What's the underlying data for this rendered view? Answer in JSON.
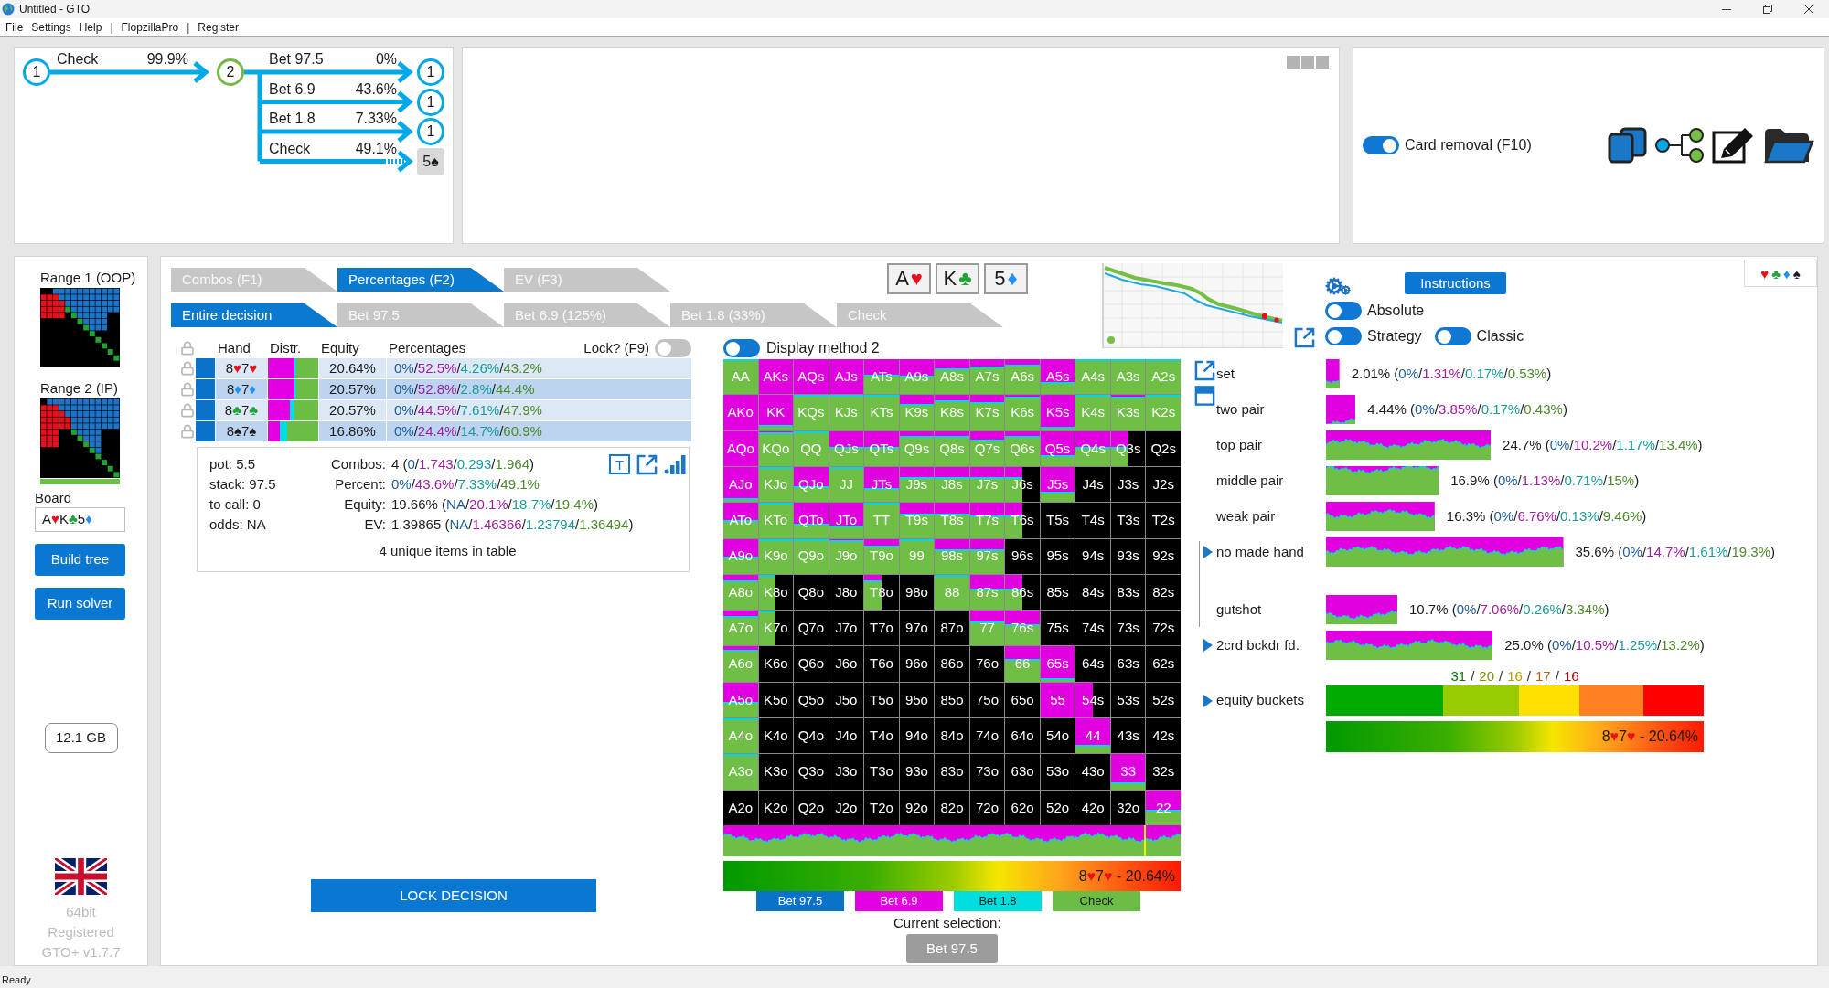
{
  "window": {
    "title": "Untitled - GTO"
  },
  "menu": [
    {
      "kind": "item",
      "label": "File"
    },
    {
      "kind": "item",
      "label": "Settings"
    },
    {
      "kind": "item",
      "label": "Help"
    },
    {
      "kind": "separator",
      "label": "|"
    },
    {
      "kind": "item",
      "label": "FlopzillaPro"
    },
    {
      "kind": "separator",
      "label": "|"
    },
    {
      "kind": "item",
      "label": "Register"
    }
  ],
  "tree": {
    "node": "1",
    "kind": "oop",
    "children": [
      {
        "action": "Check",
        "share": "99.9%",
        "node": "2",
        "kind": "ip",
        "children": [
          {
            "action": "Bet 97.5",
            "share": "0%",
            "node": "1",
            "kind": "oop"
          },
          {
            "action": "Bet 6.9",
            "share": "43.6%",
            "node": "1",
            "kind": "oop"
          },
          {
            "action": "Bet 1.8",
            "share": "7.33%",
            "node": "1",
            "kind": "oop"
          },
          {
            "action": "Check",
            "share": "49.1%",
            "node": "5♠",
            "kind": "card"
          }
        ]
      }
    ]
  },
  "card_removal": {
    "label": "Card removal (F10)",
    "on": true,
    "kind": "switch"
  },
  "sidebar": {
    "ranges": [
      {
        "label": "Range 1 (OOP)"
      },
      {
        "label": "Range 2 (IP)",
        "level": 1
      }
    ],
    "board": {
      "label": "Board",
      "cards": [
        {
          "rank": "A",
          "suit": "♥",
          "color": "#e8101c"
        },
        {
          "rank": "K",
          "suit": "♣",
          "color": "#21a336"
        },
        {
          "rank": "5",
          "suit": "♦",
          "color": "#1e90ff"
        }
      ]
    },
    "buttons": [
      "Build tree",
      "Run solver"
    ],
    "memory": "12.1 GB",
    "footer": [
      "64bit",
      "Registered",
      "GTO+ v1.7.7"
    ]
  },
  "tabs": [
    {
      "label": "Combos (F1)",
      "selected": false
    },
    {
      "label": "Percentages (F2)",
      "selected": true
    },
    {
      "label": "EV (F3)",
      "selected": false
    }
  ],
  "decision_tabs": [
    {
      "label": "Entire decision",
      "selected": true
    },
    {
      "label": "Bet 97.5",
      "selected": false
    },
    {
      "label": "Bet 6.9 (125%)",
      "selected": false
    },
    {
      "label": "Bet 1.8 (33%)",
      "selected": false
    },
    {
      "label": "Check",
      "selected": false
    }
  ],
  "board_cards": [
    {
      "rank": "A",
      "suit": "♥",
      "color": "#e8101c"
    },
    {
      "rank": "K",
      "suit": "♣",
      "color": "#21a336"
    },
    {
      "rank": "5",
      "suit": "♦",
      "color": "#1e90ff"
    }
  ],
  "table": {
    "columns": [
      "Hand",
      "Distr.",
      "Equity",
      "Percentages"
    ],
    "lock": {
      "label": "Lock? (F9)",
      "on": false,
      "kind": "switch"
    },
    "rows": [
      {
        "cards": [
          {
            "rank": "8",
            "suit": "♥",
            "color": "#e8101c"
          },
          {
            "rank": "7",
            "suit": "♥",
            "color": "#e8101c"
          }
        ],
        "equity": "20.64%",
        "values": [
          "0%",
          "52.5%",
          "4.26%",
          "43.2%"
        ],
        "sep": "/"
      },
      {
        "cards": [
          {
            "rank": "8",
            "suit": "♦",
            "color": "#1e90ff"
          },
          {
            "rank": "7",
            "suit": "♦",
            "color": "#1e90ff"
          }
        ],
        "equity": "20.57%",
        "values": [
          "0%",
          "52.8%",
          "2.8%",
          "44.4%"
        ],
        "sep": "/"
      },
      {
        "cards": [
          {
            "rank": "8",
            "suit": "♣",
            "color": "#21a336"
          },
          {
            "rank": "7",
            "suit": "♣",
            "color": "#21a336"
          }
        ],
        "equity": "20.57%",
        "values": [
          "0%",
          "44.5%",
          "7.61%",
          "47.9%"
        ],
        "sep": "/"
      },
      {
        "cards": [
          {
            "rank": "8",
            "suit": "♠",
            "color": "#1c1c1c"
          },
          {
            "rank": "7",
            "suit": "♠",
            "color": "#1c1c1c"
          }
        ],
        "equity": "16.86%",
        "values": [
          "0%",
          "24.4%",
          "14.7%",
          "60.9%"
        ],
        "sep": "/"
      }
    ]
  },
  "summary": {
    "left": [
      "pot: 5.5",
      "stack: 97.5",
      "to call: 0",
      "odds: NA"
    ],
    "right": [
      {
        "label": "Combos:",
        "lead": "4 (",
        "values": [
          "0",
          "1.743",
          "0.293",
          "1.964"
        ],
        "sep": "/",
        "tail": ")"
      },
      {
        "label": "Percent:",
        "values": [
          "0%",
          "43.6%",
          "7.33%",
          "49.1%"
        ],
        "sep": "/"
      },
      {
        "label": "Equity:",
        "lead": "19.66% (",
        "values": [
          "NA",
          "20.1%",
          "18.7%",
          "19.4%"
        ],
        "sep": "/",
        "tail": ")"
      },
      {
        "label": "EV:",
        "lead": "1.39865 (",
        "values": [
          "NA",
          "1.46366",
          "1.23794",
          "1.36494"
        ],
        "sep": "/",
        "tail": ")"
      }
    ],
    "text_button": "T",
    "footer": "4 unique items in table"
  },
  "lock_button": "LOCK DECISION",
  "display": {
    "label": "Display method 2",
    "on": false,
    "kind": "choice"
  },
  "grid": {
    "rows": [
      {
        "cells": [
          {
            "label": "AA",
            "kind": "full",
            "level": 0
          },
          {
            "label": "AKs",
            "kind": "full",
            "level": 1
          },
          {
            "label": "AQs",
            "kind": "full",
            "level": 1
          },
          {
            "label": "AJs",
            "kind": "full",
            "level": 1
          },
          {
            "label": "ATs",
            "kind": "full",
            "level": 0.5
          },
          {
            "label": "A9s",
            "kind": "full",
            "level": 0.52
          },
          {
            "label": "A8s",
            "kind": "full",
            "level": 0.32
          },
          {
            "label": "A7s",
            "kind": "full",
            "level": 0.25
          },
          {
            "label": "A6s",
            "kind": "full",
            "level": 0.2
          },
          {
            "label": "A5s",
            "kind": "full",
            "level": 0.7
          },
          {
            "label": "A4s",
            "kind": "full",
            "level": 0.03
          },
          {
            "label": "A3s",
            "kind": "full",
            "level": 0.03
          },
          {
            "label": "A2s",
            "kind": "full",
            "level": 0
          }
        ]
      },
      {
        "cells": [
          {
            "label": "AKo",
            "kind": "full",
            "level": 1
          },
          {
            "label": "KK",
            "kind": "full",
            "level": 0.9
          },
          {
            "label": "KQs",
            "kind": "full",
            "level": 0.04
          },
          {
            "label": "KJs",
            "kind": "full",
            "level": 0
          },
          {
            "label": "KTs",
            "kind": "full",
            "level": 0
          },
          {
            "label": "K9s",
            "kind": "full",
            "level": 0.3
          },
          {
            "label": "K8s",
            "kind": "full",
            "level": 0.2
          },
          {
            "label": "K7s",
            "kind": "full",
            "level": 0.25
          },
          {
            "label": "K6s",
            "kind": "full",
            "level": 0.1
          },
          {
            "label": "K5s",
            "kind": "full",
            "level": 0.95
          },
          {
            "label": "K4s",
            "kind": "full",
            "level": 0.05
          },
          {
            "label": "K3s",
            "kind": "full",
            "level": 0.1
          },
          {
            "label": "K2s",
            "kind": "full",
            "level": 0.02
          }
        ]
      },
      {
        "cells": [
          {
            "label": "AQo",
            "kind": "full",
            "level": 1
          },
          {
            "label": "KQo",
            "kind": "full",
            "level": 0.08
          },
          {
            "label": "QQ",
            "kind": "full",
            "level": 0
          },
          {
            "label": "QJs",
            "kind": "full",
            "level": 0.5
          },
          {
            "label": "QTs",
            "kind": "full",
            "level": 0.5
          },
          {
            "label": "Q9s",
            "kind": "full",
            "level": 0.2
          },
          {
            "label": "Q8s",
            "kind": "full",
            "level": 0.2
          },
          {
            "label": "Q7s",
            "kind": "full",
            "level": 0.3
          },
          {
            "label": "Q6s",
            "kind": "full",
            "level": 0.2
          },
          {
            "label": "Q5s",
            "kind": "full",
            "level": 0.75
          },
          {
            "label": "Q4s",
            "kind": "full",
            "level": 0.5
          },
          {
            "label": "Q3s",
            "kind": "partial",
            "level": 0.5
          },
          {
            "label": "Q2s",
            "kind": "empty"
          }
        ]
      },
      {
        "cells": [
          {
            "label": "AJo",
            "kind": "full",
            "level": 0.95
          },
          {
            "label": "KJo",
            "kind": "full",
            "level": 0.04
          },
          {
            "label": "QJo",
            "kind": "full",
            "level": 0.6
          },
          {
            "label": "JJ",
            "kind": "full",
            "level": 0
          },
          {
            "label": "JTs",
            "kind": "full",
            "level": 0.65
          },
          {
            "label": "J9s",
            "kind": "full",
            "level": 0.35
          },
          {
            "label": "J8s",
            "kind": "full",
            "level": 0.35
          },
          {
            "label": "J7s",
            "kind": "full",
            "level": 0.35
          },
          {
            "label": "J6s",
            "kind": "partial",
            "level": 0.35
          },
          {
            "label": "J5s",
            "kind": "full",
            "level": 0.75
          },
          {
            "label": "J4s",
            "kind": "empty"
          },
          {
            "label": "J3s",
            "kind": "empty"
          },
          {
            "label": "J2s",
            "kind": "empty"
          }
        ]
      },
      {
        "cells": [
          {
            "label": "ATo",
            "kind": "full",
            "level": 0.55
          },
          {
            "label": "KTo",
            "kind": "full",
            "level": 0
          },
          {
            "label": "QTo",
            "kind": "full",
            "level": 0.65
          },
          {
            "label": "JTo",
            "kind": "full",
            "level": 0.7
          },
          {
            "label": "TT",
            "kind": "full",
            "level": 0
          },
          {
            "label": "T9s",
            "kind": "full",
            "level": 0.35
          },
          {
            "label": "T8s",
            "kind": "full",
            "level": 0.35
          },
          {
            "label": "T7s",
            "kind": "full",
            "level": 0.4
          },
          {
            "label": "T6s",
            "kind": "partial",
            "level": 0.4
          },
          {
            "label": "T5s",
            "kind": "empty"
          },
          {
            "label": "T4s",
            "kind": "empty"
          },
          {
            "label": "T3s",
            "kind": "empty"
          },
          {
            "label": "T2s",
            "kind": "empty"
          }
        ]
      },
      {
        "cells": [
          {
            "label": "A9o",
            "kind": "full",
            "level": 0.55
          },
          {
            "label": "K9o",
            "kind": "full",
            "level": 0.05
          },
          {
            "label": "Q9o",
            "kind": "full",
            "level": 0.05
          },
          {
            "label": "J9o",
            "kind": "full",
            "level": 0.1
          },
          {
            "label": "T9o",
            "kind": "full",
            "level": 0.25
          },
          {
            "label": "99",
            "kind": "full",
            "level": 0
          },
          {
            "label": "98s",
            "kind": "full",
            "level": 0.35
          },
          {
            "label": "97s",
            "kind": "full",
            "level": 0.35
          },
          {
            "label": "96s",
            "kind": "empty"
          },
          {
            "label": "95s",
            "kind": "empty"
          },
          {
            "label": "94s",
            "kind": "empty"
          },
          {
            "label": "93s",
            "kind": "empty"
          },
          {
            "label": "92s",
            "kind": "empty"
          }
        ]
      },
      {
        "cells": [
          {
            "label": "A8o",
            "kind": "full",
            "level": 0.2
          },
          {
            "label": "K8o",
            "kind": "partial",
            "level": 0.05
          },
          {
            "label": "Q8o",
            "kind": "empty"
          },
          {
            "label": "J8o",
            "kind": "empty"
          },
          {
            "label": "T8o",
            "kind": "partial",
            "level": 0.2
          },
          {
            "label": "98o",
            "kind": "empty"
          },
          {
            "label": "88",
            "kind": "full",
            "level": 0.05
          },
          {
            "label": "87s",
            "kind": "full",
            "level": 0.45
          },
          {
            "label": "86s",
            "kind": "partial",
            "level": 0.45
          },
          {
            "label": "85s",
            "kind": "empty"
          },
          {
            "label": "84s",
            "kind": "empty"
          },
          {
            "label": "83s",
            "kind": "empty"
          },
          {
            "label": "82s",
            "kind": "empty"
          }
        ]
      },
      {
        "cells": [
          {
            "label": "A7o",
            "kind": "full",
            "level": 0.2
          },
          {
            "label": "K7o",
            "kind": "partial",
            "level": 0.05
          },
          {
            "label": "Q7o",
            "kind": "empty"
          },
          {
            "label": "J7o",
            "kind": "empty"
          },
          {
            "label": "T7o",
            "kind": "empty"
          },
          {
            "label": "97o",
            "kind": "empty"
          },
          {
            "label": "87o",
            "kind": "empty"
          },
          {
            "label": "77",
            "kind": "full",
            "level": 0.35
          },
          {
            "label": "76s",
            "kind": "full",
            "level": 0.45
          },
          {
            "label": "75s",
            "kind": "empty"
          },
          {
            "label": "74s",
            "kind": "empty"
          },
          {
            "label": "73s",
            "kind": "empty"
          },
          {
            "label": "72s",
            "kind": "empty"
          }
        ]
      },
      {
        "cells": [
          {
            "label": "A6o",
            "kind": "full",
            "level": 0.15
          },
          {
            "label": "K6o",
            "kind": "empty"
          },
          {
            "label": "Q6o",
            "kind": "empty"
          },
          {
            "label": "J6o",
            "kind": "empty"
          },
          {
            "label": "T6o",
            "kind": "empty"
          },
          {
            "label": "96o",
            "kind": "empty"
          },
          {
            "label": "86o",
            "kind": "empty"
          },
          {
            "label": "76o",
            "kind": "empty"
          },
          {
            "label": "66",
            "kind": "full",
            "level": 0.4
          },
          {
            "label": "65s",
            "kind": "full",
            "level": 0.95
          },
          {
            "label": "64s",
            "kind": "empty"
          },
          {
            "label": "63s",
            "kind": "empty"
          },
          {
            "label": "62s",
            "kind": "empty"
          }
        ]
      },
      {
        "cells": [
          {
            "label": "A5o",
            "kind": "full",
            "level": 0.6
          },
          {
            "label": "K5o",
            "kind": "empty"
          },
          {
            "label": "Q5o",
            "kind": "empty"
          },
          {
            "label": "J5o",
            "kind": "empty"
          },
          {
            "label": "T5o",
            "kind": "empty"
          },
          {
            "label": "95o",
            "kind": "empty"
          },
          {
            "label": "85o",
            "kind": "empty"
          },
          {
            "label": "75o",
            "kind": "empty"
          },
          {
            "label": "65o",
            "kind": "empty"
          },
          {
            "label": "55",
            "kind": "full",
            "level": 1
          },
          {
            "label": "54s",
            "kind": "partial",
            "level": 1
          },
          {
            "label": "53s",
            "kind": "empty"
          },
          {
            "label": "52s",
            "kind": "empty"
          }
        ]
      },
      {
        "cells": [
          {
            "label": "A4o",
            "kind": "full",
            "level": 0.05
          },
          {
            "label": "K4o",
            "kind": "empty"
          },
          {
            "label": "Q4o",
            "kind": "empty"
          },
          {
            "label": "J4o",
            "kind": "empty"
          },
          {
            "label": "T4o",
            "kind": "empty"
          },
          {
            "label": "94o",
            "kind": "empty"
          },
          {
            "label": "84o",
            "kind": "empty"
          },
          {
            "label": "74o",
            "kind": "empty"
          },
          {
            "label": "64o",
            "kind": "empty"
          },
          {
            "label": "54o",
            "kind": "empty"
          },
          {
            "label": "44",
            "kind": "full",
            "level": 0.8
          },
          {
            "label": "43s",
            "kind": "empty"
          },
          {
            "label": "42s",
            "kind": "empty"
          }
        ]
      },
      {
        "cells": [
          {
            "label": "A3o",
            "kind": "full",
            "level": 0.05
          },
          {
            "label": "K3o",
            "kind": "empty"
          },
          {
            "label": "Q3o",
            "kind": "empty"
          },
          {
            "label": "J3o",
            "kind": "empty"
          },
          {
            "label": "T3o",
            "kind": "empty"
          },
          {
            "label": "93o",
            "kind": "empty"
          },
          {
            "label": "83o",
            "kind": "empty"
          },
          {
            "label": "73o",
            "kind": "empty"
          },
          {
            "label": "63o",
            "kind": "empty"
          },
          {
            "label": "53o",
            "kind": "empty"
          },
          {
            "label": "43o",
            "kind": "empty"
          },
          {
            "label": "33",
            "kind": "full",
            "level": 0.85
          },
          {
            "label": "32s",
            "kind": "empty"
          }
        ]
      },
      {
        "cells": [
          {
            "label": "A2o",
            "kind": "empty"
          },
          {
            "label": "K2o",
            "kind": "empty"
          },
          {
            "label": "Q2o",
            "kind": "empty"
          },
          {
            "label": "J2o",
            "kind": "empty"
          },
          {
            "label": "T2o",
            "kind": "empty"
          },
          {
            "label": "92o",
            "kind": "empty"
          },
          {
            "label": "82o",
            "kind": "empty"
          },
          {
            "label": "72o",
            "kind": "empty"
          },
          {
            "label": "62o",
            "kind": "empty"
          },
          {
            "label": "52o",
            "kind": "empty"
          },
          {
            "label": "42o",
            "kind": "empty"
          },
          {
            "label": "32o",
            "kind": "empty"
          },
          {
            "label": "22",
            "kind": "full",
            "level": 0.6
          }
        ]
      }
    ]
  },
  "actions": [
    {
      "label": "Bet 97.5",
      "color": "#0b72c9"
    },
    {
      "label": "Bet 6.9",
      "color": "#e300e3"
    },
    {
      "label": "Bet 1.8",
      "color": "#00dede"
    },
    {
      "label": "Check",
      "color": "#6cbd45"
    }
  ],
  "equity_bar": {
    "cards": [
      {
        "rank": "8",
        "suit": "♥",
        "color": "#e8101c"
      },
      {
        "rank": "7",
        "suit": "♥",
        "color": "#e8101c"
      }
    ],
    "text": "- 20.64%"
  },
  "selection": {
    "label": "Current selection:",
    "value": "Bet 97.5"
  },
  "instructions": "Instructions",
  "toggles": [
    {
      "label": "Absolute",
      "on": false,
      "kind": "choice"
    },
    {
      "label": "Strategy",
      "on": false,
      "kind": "choice"
    },
    {
      "label": "Classic",
      "on": false,
      "kind": "choice"
    }
  ],
  "suit_legend": [
    {
      "symbol": "♥",
      "color": "#e8101c"
    },
    {
      "symbol": "♣",
      "color": "#21a336"
    },
    {
      "symbol": "♦",
      "color": "#1e90ff"
    },
    {
      "symbol": "♠",
      "color": "#1c1c1c"
    }
  ],
  "hand_classes": [
    {
      "label": "set",
      "kind": "class",
      "lead": "2.01% (",
      "values": [
        "0%",
        "1.31%",
        "0.17%",
        "0.53%"
      ],
      "sep": "/",
      "tail": ")"
    },
    {
      "label": "two pair",
      "kind": "class",
      "lead": "4.44% (",
      "values": [
        "0%",
        "3.85%",
        "0.17%",
        "0.43%"
      ],
      "sep": "/",
      "tail": ")"
    },
    {
      "label": "top pair",
      "kind": "class",
      "lead": "24.7% (",
      "values": [
        "0%",
        "10.2%",
        "1.17%",
        "13.4%"
      ],
      "sep": "/",
      "tail": ")"
    },
    {
      "label": "middle pair",
      "kind": "class",
      "lead": "16.9% (",
      "values": [
        "0%",
        "1.13%",
        "0.71%",
        "15%"
      ],
      "sep": "/",
      "tail": ")"
    },
    {
      "label": "weak pair",
      "kind": "class",
      "lead": "16.3% (",
      "values": [
        "0%",
        "6.76%",
        "0.13%",
        "9.46%"
      ],
      "sep": "/",
      "tail": ")"
    },
    {
      "label": "no made hand",
      "kind": "group",
      "lead": "35.6% (",
      "values": [
        "0%",
        "14.7%",
        "1.61%",
        "19.3%"
      ],
      "sep": "/",
      "tail": ")",
      "children": [
        {
          "label": "gutshot",
          "kind": "class",
          "lead": "10.7% (",
          "values": [
            "0%",
            "7.06%",
            "0.26%",
            "3.34%"
          ],
          "sep": "/",
          "tail": ")"
        }
      ]
    },
    {
      "label": "2crd bckdr fd.",
      "kind": "group",
      "lead": "25.0% (",
      "values": [
        "0%",
        "10.5%",
        "1.25%",
        "13.2%"
      ],
      "sep": "/",
      "tail": ")"
    }
  ],
  "equity_buckets": {
    "label": "equity buckets",
    "kind": "group",
    "sep": "/",
    "buckets": [
      {
        "value": "31",
        "color": "#00aa00"
      },
      {
        "value": "20",
        "color": "#99cc00"
      },
      {
        "value": "16",
        "color": "#ffe000"
      },
      {
        "value": "17",
        "color": "#ff8020"
      },
      {
        "value": "16",
        "color": "#ff0000"
      }
    ],
    "equity_bar": {
      "cards": [
        {
          "rank": "8",
          "suit": "♥",
          "color": "#e8101c"
        },
        {
          "rank": "7",
          "suit": "♥",
          "color": "#e8101c"
        }
      ],
      "text": "- 20.64%"
    }
  },
  "status_bar": "Ready"
}
